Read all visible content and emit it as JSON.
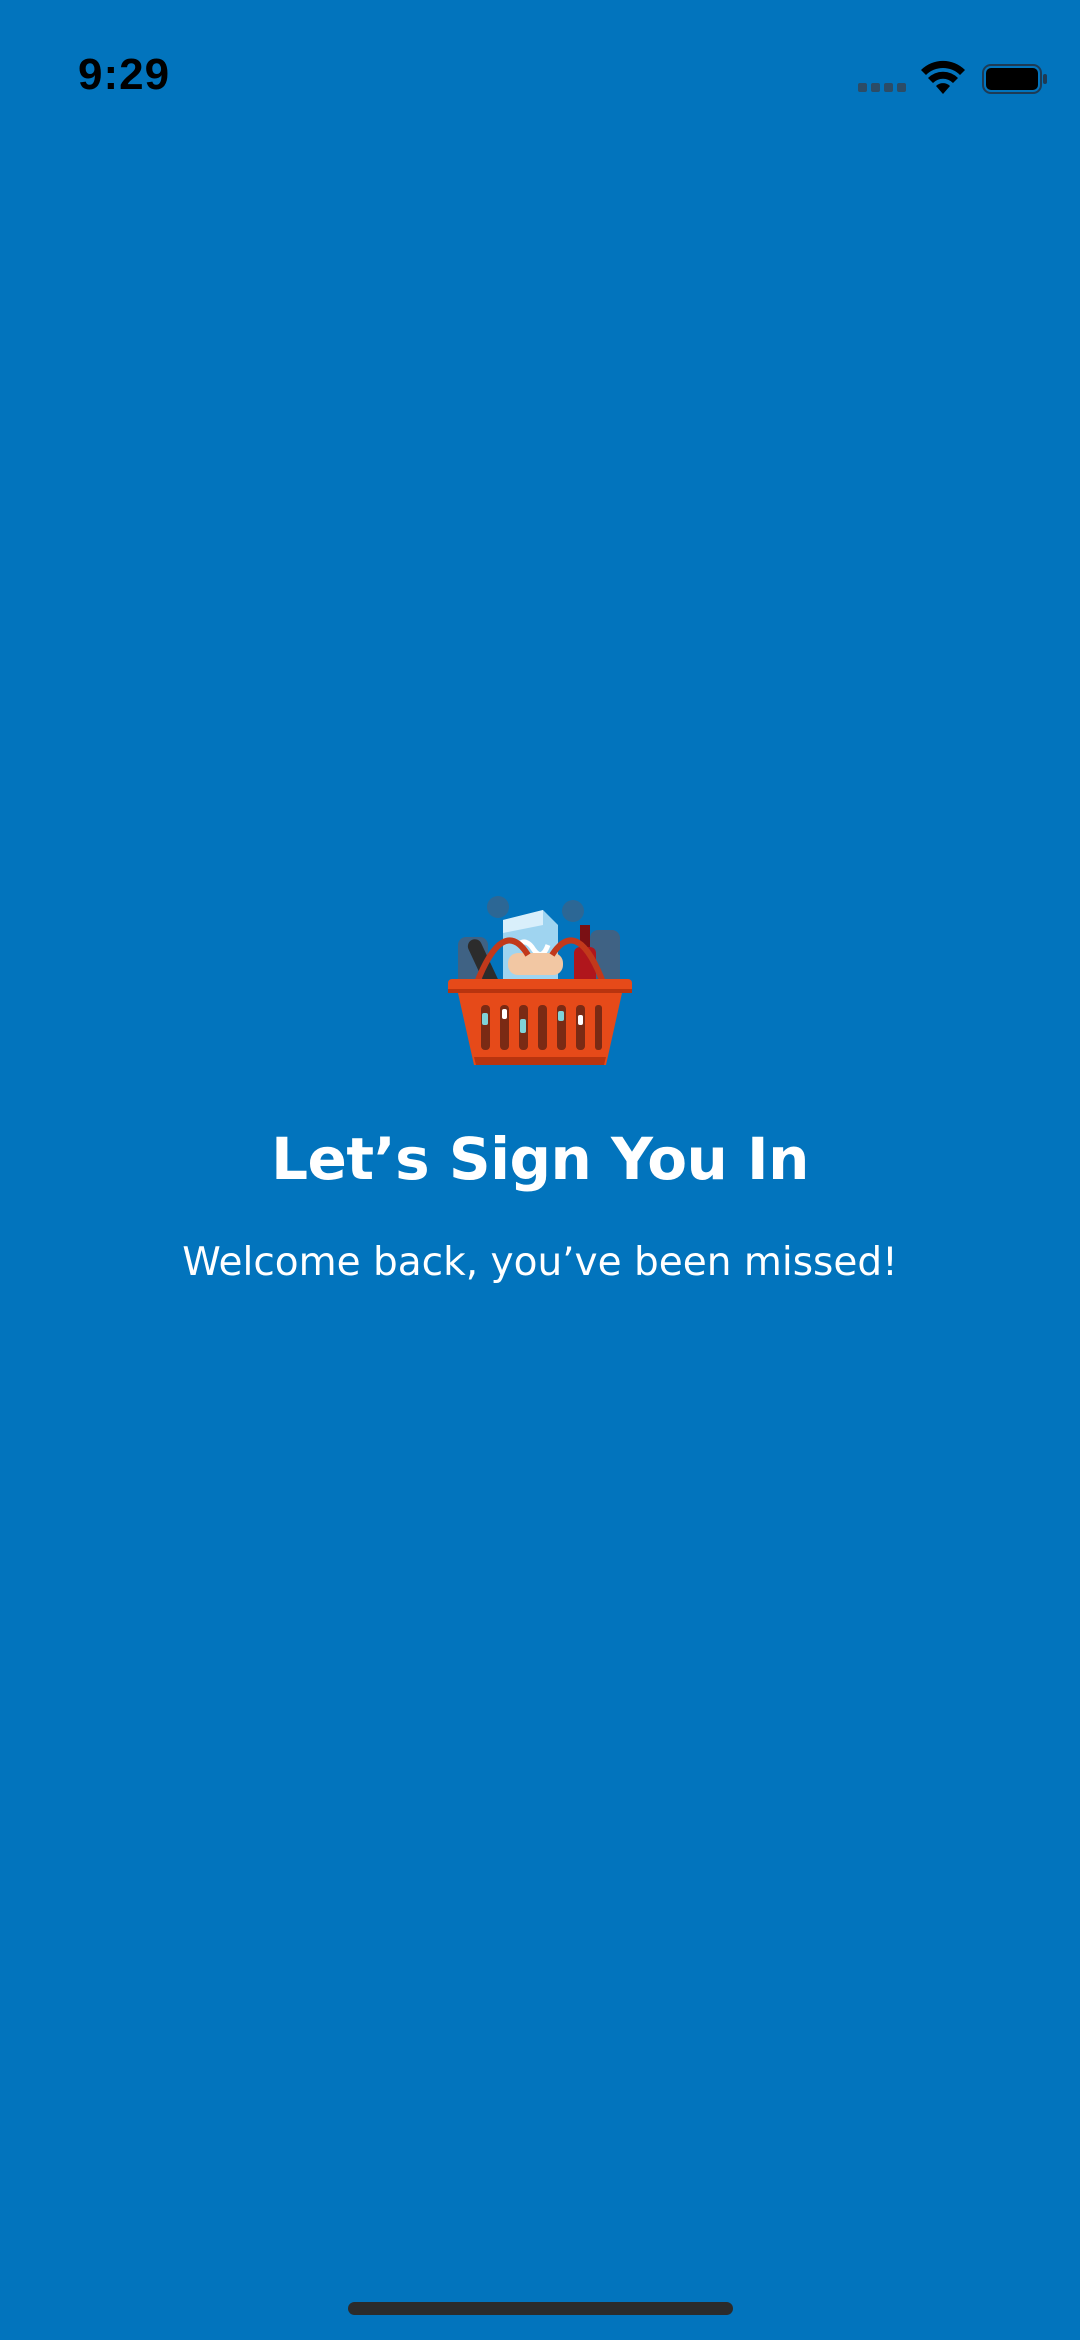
{
  "status_bar": {
    "time": "9:29",
    "signal_icon": "cellular-signal-icon",
    "wifi_icon": "wifi-icon",
    "battery_icon": "battery-icon"
  },
  "screen": {
    "illustration": "shopping-basket-icon",
    "title": "Let’s Sign You In",
    "subtitle": "Welcome back, you’ve been missed!"
  },
  "colors": {
    "background": "#0274BD",
    "text": "#FFFFFF",
    "basket": "#E64A19"
  }
}
